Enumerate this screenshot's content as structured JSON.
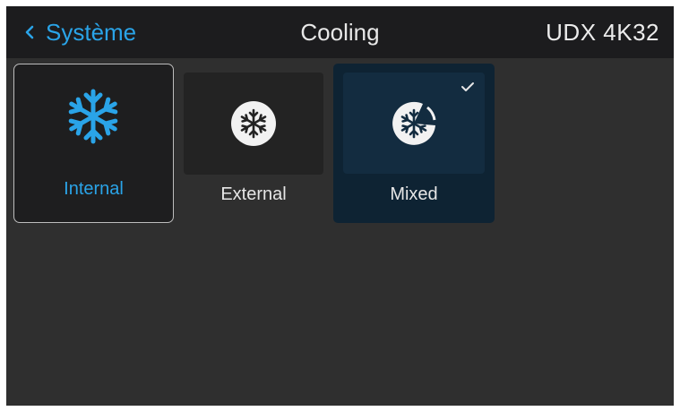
{
  "header": {
    "back_label": "Système",
    "title": "Cooling",
    "model": "UDX 4K32"
  },
  "options": [
    {
      "label": "Internal",
      "icon": "snowflake-icon",
      "focused": true,
      "selected": false
    },
    {
      "label": "External",
      "icon": "snowflake-circle-icon",
      "focused": false,
      "selected": false
    },
    {
      "label": "Mixed",
      "icon": "snowflake-mixed-icon",
      "focused": false,
      "selected": true
    }
  ],
  "colors": {
    "accent": "#2aa4e8",
    "background": "#2f2f2f",
    "header": "#1c1c1e",
    "selected_tile": "#0e2333"
  }
}
